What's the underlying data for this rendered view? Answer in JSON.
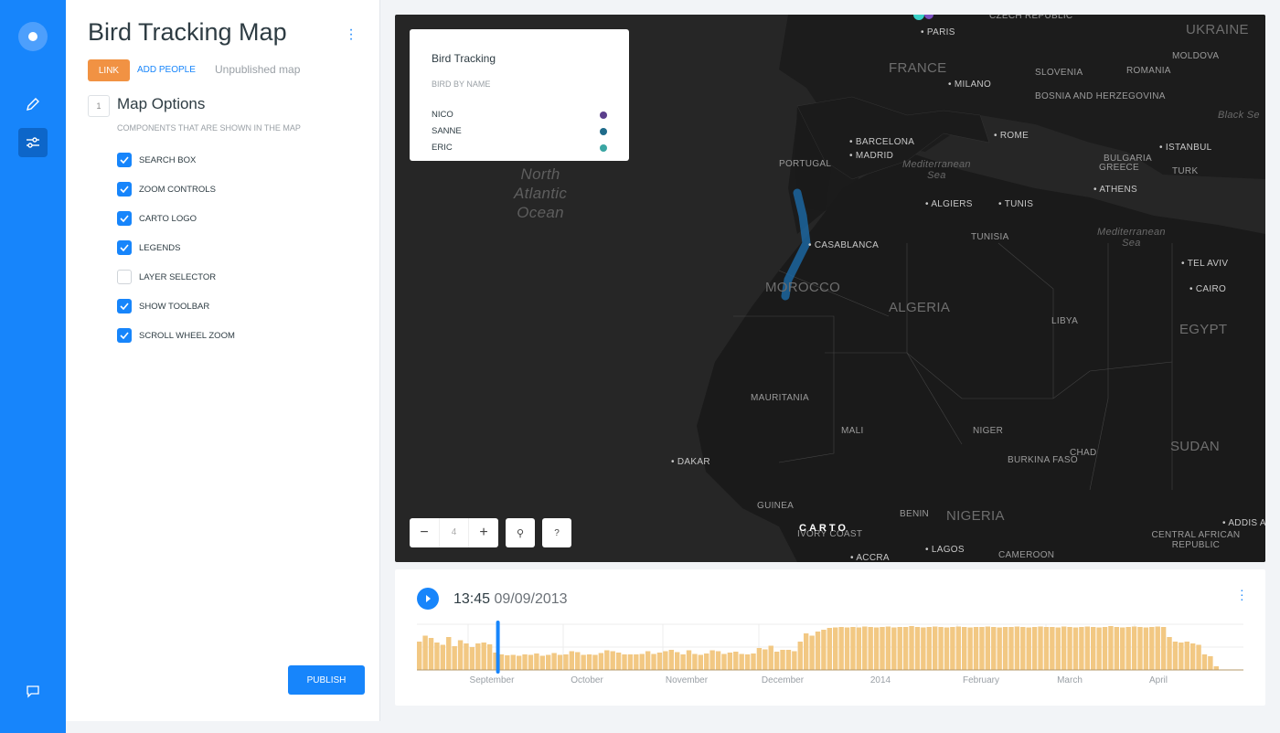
{
  "nav": {
    "icons": [
      "carto-logo-icon",
      "pencil-icon",
      "sliders-icon",
      "chat-icon"
    ]
  },
  "panel": {
    "title": "Bird Tracking Map",
    "link_label": "LINK",
    "add_people": "ADD PEOPLE",
    "status": "Unpublished map",
    "step": "1",
    "section": "Map Options",
    "subtitle": "COMPONENTS THAT ARE SHOWN IN THE MAP",
    "options": [
      {
        "label": "SEARCH BOX",
        "checked": true
      },
      {
        "label": "ZOOM CONTROLS",
        "checked": true
      },
      {
        "label": "CARTO LOGO",
        "checked": true
      },
      {
        "label": "LEGENDS",
        "checked": true
      },
      {
        "label": "LAYER SELECTOR",
        "checked": false
      },
      {
        "label": "SHOW TOOLBAR",
        "checked": true
      },
      {
        "label": "SCROLL WHEEL ZOOM",
        "checked": true
      }
    ],
    "publish": "PUBLISH"
  },
  "map": {
    "legend": {
      "title": "Bird Tracking",
      "subtitle": "BIRD BY NAME",
      "items": [
        {
          "name": "NICO",
          "color": "#5b3f8c"
        },
        {
          "name": "SANNE",
          "color": "#1f6b8a"
        },
        {
          "name": "ERIC",
          "color": "#3aa6a3"
        }
      ]
    },
    "zoom_level": "4",
    "help": "?",
    "carto": "CARTO",
    "labels": {
      "ocean": "North\nAtlantic\nOcean",
      "med1": "Mediterranean\nSea",
      "med2": "Mediterranean\nSea",
      "black": "Black Se",
      "countries": [
        "FRANCE",
        "UKRAINE",
        "CZECH REPUBLIC",
        "SLOVENIA",
        "MOLDOVA",
        "ROMANIA",
        "BOSNIA AND HERZEGOVINA",
        "BULGARIA",
        "GREECE",
        "TURK",
        "PORTUGAL",
        "TUNISIA",
        "MOROCCO",
        "ALGERIA",
        "LIBYA",
        "EGYPT",
        "MAURITANIA",
        "MALI",
        "NIGER",
        "CHAD",
        "SUDAN",
        "BURKINA FASO",
        "GUINEA",
        "NIGERIA",
        "BENIN",
        "IVORY COAST",
        "CAMEROON",
        "CENTRAL AFRICAN REPUBLIC"
      ],
      "cities": [
        "PARIS",
        "MILANO",
        "ROME",
        "BARCELONA",
        "MADRID",
        "ISTANBUL",
        "ATHENS",
        "ALGIERS",
        "TUNIS",
        "CASABLANCA",
        "TEL AVIV",
        "CAIRO",
        "DAKAR",
        "LAGOS",
        "ACCRA",
        "ADDIS AB"
      ]
    }
  },
  "timeline": {
    "time": "13:45",
    "date": "09/09/2013",
    "months": [
      "September",
      "October",
      "November",
      "December",
      "2014",
      "February",
      "March",
      "April"
    ],
    "histogram": [
      0.62,
      0.75,
      0.7,
      0.6,
      0.55,
      0.72,
      0.52,
      0.65,
      0.58,
      0.5,
      0.58,
      0.6,
      0.56,
      0.38,
      0.34,
      0.32,
      0.33,
      0.31,
      0.34,
      0.33,
      0.36,
      0.31,
      0.33,
      0.37,
      0.33,
      0.34,
      0.41,
      0.39,
      0.33,
      0.34,
      0.33,
      0.37,
      0.43,
      0.41,
      0.38,
      0.34,
      0.34,
      0.34,
      0.35,
      0.41,
      0.35,
      0.38,
      0.41,
      0.44,
      0.39,
      0.34,
      0.43,
      0.35,
      0.33,
      0.36,
      0.43,
      0.41,
      0.35,
      0.38,
      0.4,
      0.35,
      0.34,
      0.36,
      0.48,
      0.45,
      0.53,
      0.4,
      0.44,
      0.44,
      0.41,
      0.62,
      0.8,
      0.75,
      0.84,
      0.88,
      0.92,
      0.93,
      0.94,
      0.93,
      0.94,
      0.93,
      0.95,
      0.94,
      0.93,
      0.94,
      0.95,
      0.93,
      0.94,
      0.94,
      0.96,
      0.94,
      0.93,
      0.94,
      0.95,
      0.94,
      0.93,
      0.94,
      0.95,
      0.94,
      0.93,
      0.94,
      0.94,
      0.95,
      0.94,
      0.93,
      0.94,
      0.94,
      0.95,
      0.94,
      0.93,
      0.94,
      0.95,
      0.94,
      0.94,
      0.93,
      0.95,
      0.94,
      0.93,
      0.94,
      0.95,
      0.94,
      0.93,
      0.94,
      0.96,
      0.94,
      0.93,
      0.94,
      0.95,
      0.94,
      0.93,
      0.94,
      0.95,
      0.94,
      0.72,
      0.62,
      0.6,
      0.62,
      0.58,
      0.55,
      0.34,
      0.3,
      0.08
    ],
    "cursor_fraction": 0.098,
    "colors": {
      "bar": "#f2c883",
      "cursor": "#1785fb"
    }
  }
}
